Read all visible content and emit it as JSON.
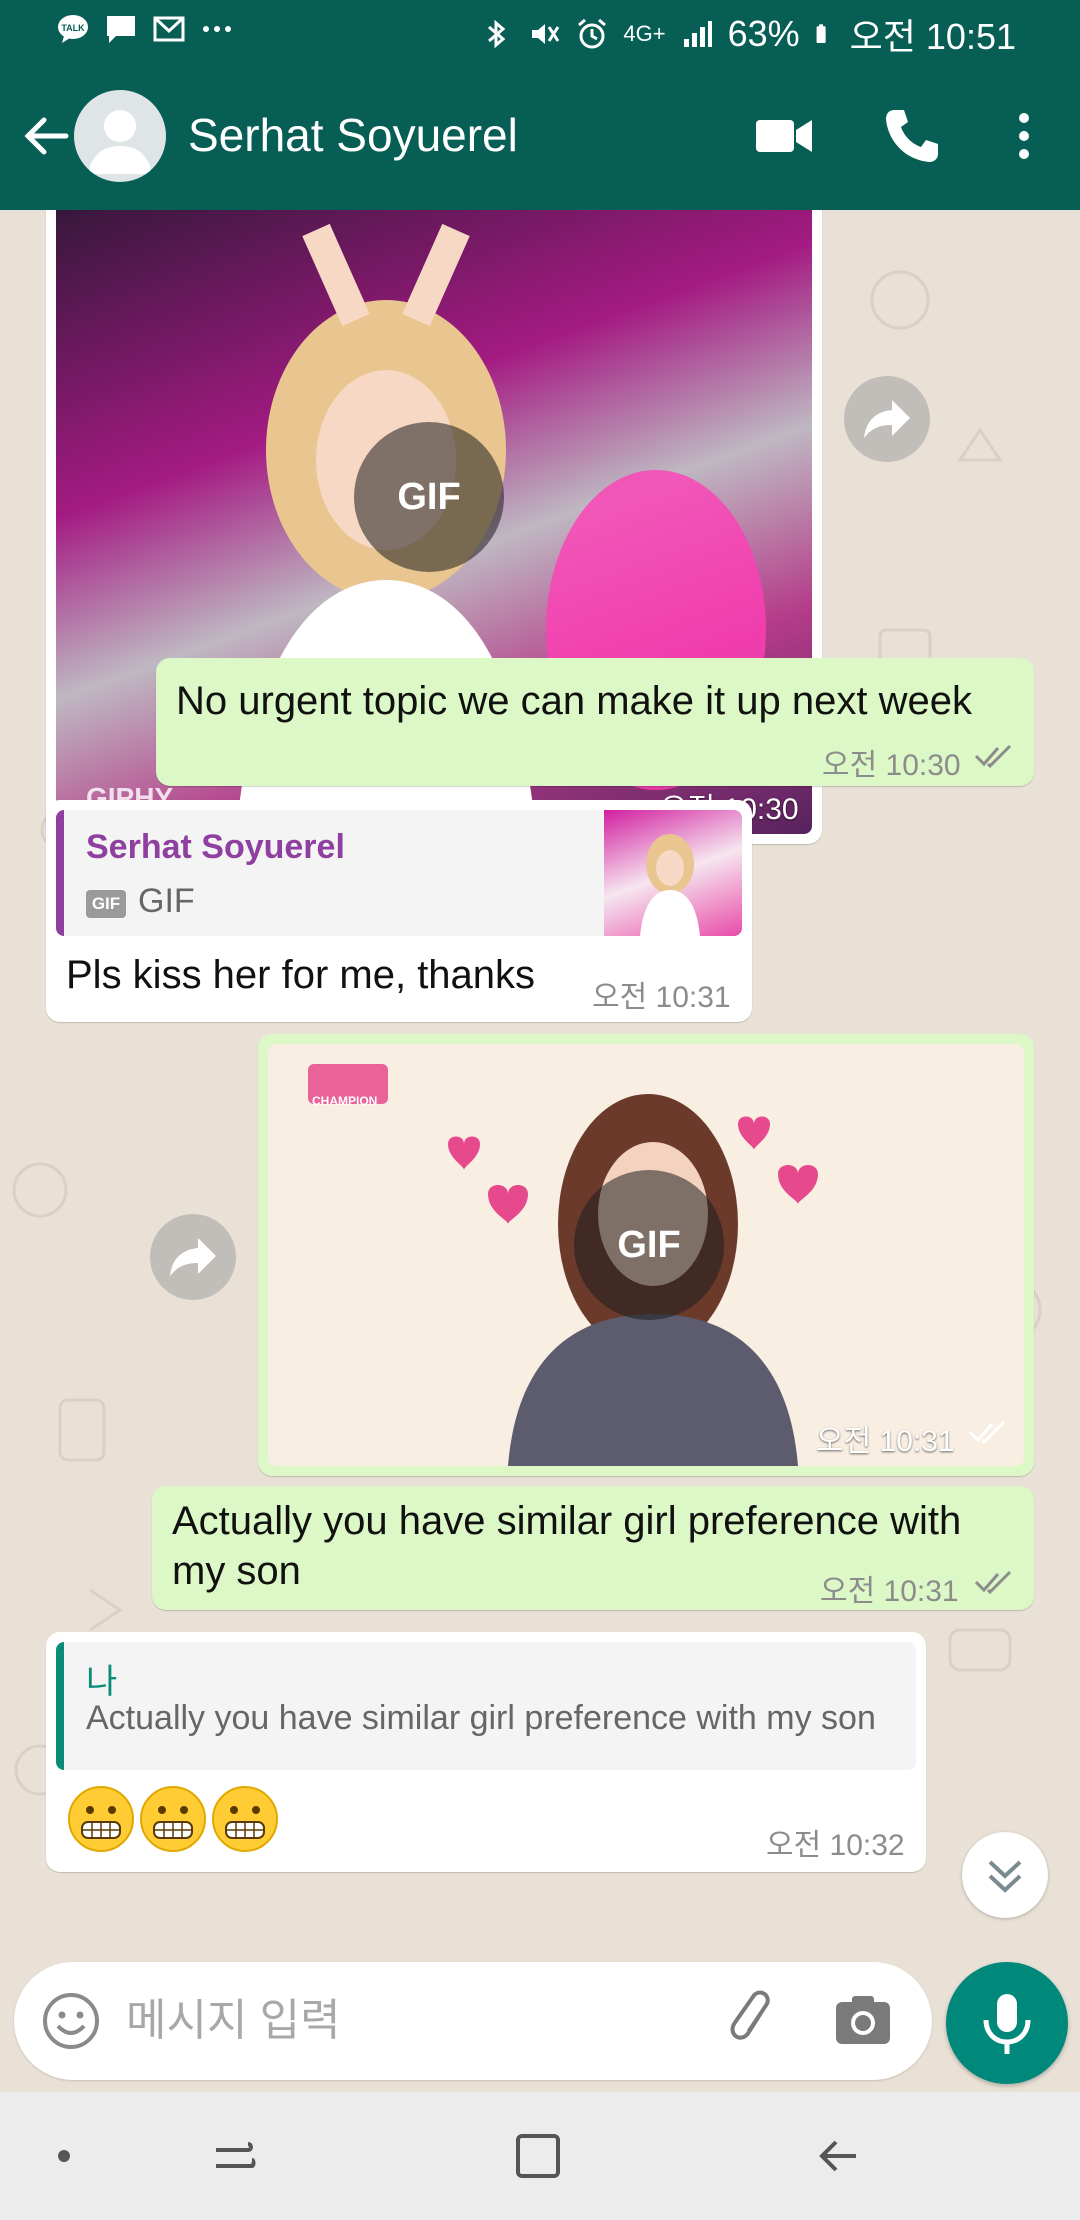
{
  "status_bar": {
    "left_icons": [
      "talk-icon",
      "chat-bubble-icon",
      "mail-icon",
      "more-dots-icon"
    ],
    "right_icons": [
      "bluetooth-icon",
      "mute-icon",
      "alarm-icon",
      "signal-icon"
    ],
    "network": "4G+",
    "battery": "63%",
    "time": "오전 10:51"
  },
  "header": {
    "contact_name": "Serhat Soyuerel",
    "color": "#075e54"
  },
  "messages": [
    {
      "type": "gif",
      "direction": "in",
      "badge": "GIF",
      "watermark": "GIPHY",
      "time": "오전 10:30"
    },
    {
      "type": "text",
      "direction": "out",
      "text": "No urgent topic we can make it up next week",
      "time": "오전 10:30"
    },
    {
      "type": "reply",
      "direction": "in",
      "quote_name": "Serhat Soyuerel",
      "quote_label": "GIF",
      "quote_chip": "GIF",
      "text": "Pls kiss her for me, thanks",
      "time": "오전 10:31"
    },
    {
      "type": "gif",
      "direction": "out",
      "badge": "GIF",
      "watermark": "CHAMPION",
      "time": "오전 10:31"
    },
    {
      "type": "text",
      "direction": "out",
      "text": "Actually you have similar girl preference with my son",
      "time": "오전 10:31"
    },
    {
      "type": "reply",
      "direction": "in",
      "quote_name": "나",
      "quote_text": "Actually you have similar girl preference with my son",
      "text_emojis": [
        "grimacing-face",
        "grimacing-face",
        "grimacing-face"
      ],
      "time": "오전 10:32"
    }
  ],
  "input": {
    "placeholder": "메시지 입력"
  },
  "colors": {
    "incoming": "#ffffff",
    "outgoing": "#dcf8c6",
    "accent": "#00897b",
    "quote_sender": "#8e3fa0",
    "quote_self": "#0b8c78",
    "read_ticks": "#8c8c8c"
  }
}
